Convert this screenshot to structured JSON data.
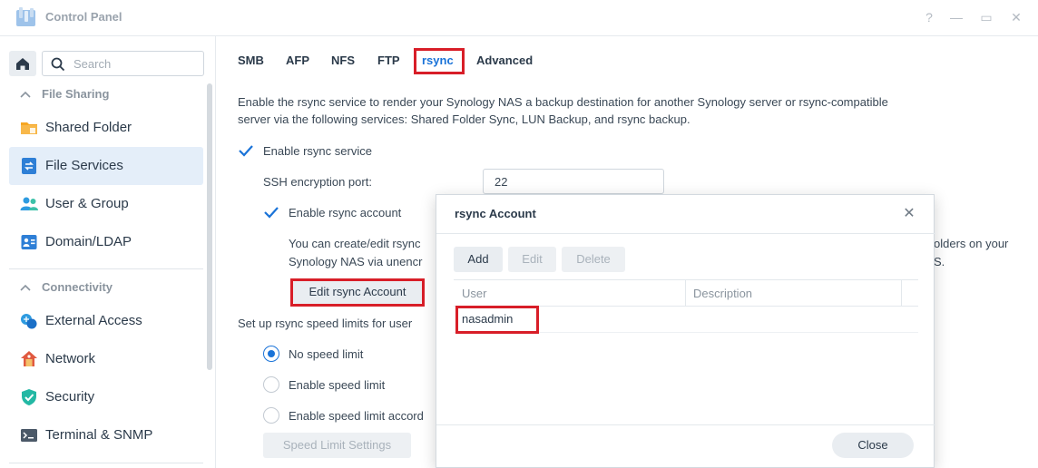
{
  "window": {
    "title": "Control Panel",
    "controls": [
      "?",
      "—",
      "▭",
      "✕"
    ]
  },
  "sidebar": {
    "search_placeholder": "Search",
    "sections": [
      {
        "label": "File Sharing",
        "items": [
          {
            "label": "Shared Folder",
            "icon": "folder-icon"
          },
          {
            "label": "File Services",
            "icon": "file-services-icon",
            "active": true
          },
          {
            "label": "User & Group",
            "icon": "user-group-icon"
          },
          {
            "label": "Domain/LDAP",
            "icon": "domain-icon"
          }
        ]
      },
      {
        "label": "Connectivity",
        "items": [
          {
            "label": "External Access",
            "icon": "external-access-icon"
          },
          {
            "label": "Network",
            "icon": "network-icon"
          },
          {
            "label": "Security",
            "icon": "security-shield-icon"
          },
          {
            "label": "Terminal & SNMP",
            "icon": "terminal-icon"
          }
        ]
      }
    ]
  },
  "tabs": [
    "SMB",
    "AFP",
    "NFS",
    "FTP",
    "rsync",
    "Advanced"
  ],
  "active_tab": "rsync",
  "rsync": {
    "description_line1": "Enable the rsync service to render your Synology NAS a backup destination for another Synology server or rsync-compatible",
    "description_line2": "server via the following services: Shared Folder Sync, LUN Backup, and rsync backup.",
    "enable_service_label": "Enable rsync service",
    "ssh_port_label": "SSH encryption port:",
    "ssh_port_value": "22",
    "enable_account_label": "Enable rsync account",
    "account_desc_line1_left": "You can create/edit rsync",
    "account_desc_line1_right": "olders on your",
    "account_desc_line2_left": "Synology NAS via unencr",
    "account_desc_line2_right": "S.",
    "edit_account_button": "Edit rsync Account",
    "speed_limits_label": "Set up rsync speed limits for user",
    "speed_options": [
      "No speed limit",
      "Enable speed limit",
      "Enable speed limit accord"
    ],
    "selected_speed_option": 0,
    "speed_settings_button": "Speed Limit Settings"
  },
  "modal": {
    "title": "rsync Account",
    "buttons": {
      "add": "Add",
      "edit": "Edit",
      "delete": "Delete",
      "close": "Close"
    },
    "columns": [
      "User",
      "Description"
    ],
    "rows": [
      {
        "user": "nasadmin",
        "description": ""
      }
    ]
  },
  "colors": {
    "accent": "#1a73d8",
    "highlight": "#d81e28",
    "active_nav_bg": "#e4eef9"
  }
}
